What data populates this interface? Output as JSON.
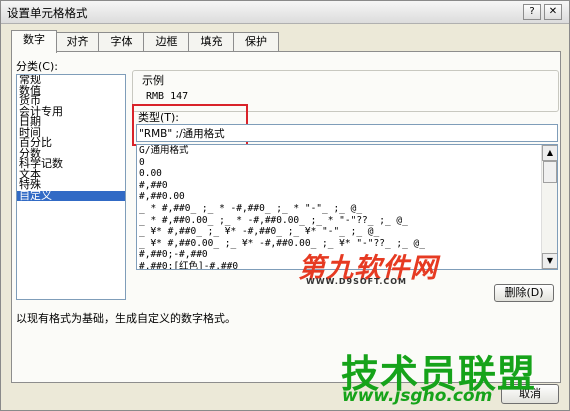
{
  "window": {
    "title": "设置单元格格式",
    "help_label": "?",
    "close_label": "✕"
  },
  "tabs": [
    "数字",
    "对齐",
    "字体",
    "边框",
    "填充",
    "保护"
  ],
  "category": {
    "label": "分类(C):",
    "items": [
      "常规",
      "数值",
      "货币",
      "会计专用",
      "日期",
      "时间",
      "百分比",
      "分数",
      "科学记数",
      "文本",
      "特殊",
      "自定义"
    ],
    "selected": "自定义"
  },
  "sample": {
    "label": "示例",
    "value": "RMB 147"
  },
  "type": {
    "label": "类型(T):",
    "value": "\"RMB\" ;/通用格式"
  },
  "format_list": [
    "G/通用格式",
    "0",
    "0.00",
    "#,##0",
    "#,##0.00",
    "_ * #,##0_ ;_ * -#,##0_ ;_ * \"-\"_ ;_ @_",
    "_ * #,##0.00_ ;_ * -#,##0.00_ ;_ * \"-\"??_ ;_ @_",
    "_ ¥* #,##0_ ;_ ¥* -#,##0_ ;_ ¥* \"-\"_ ;_ @_",
    "_ ¥* #,##0.00_ ;_ ¥* -#,##0.00_ ;_ ¥* \"-\"??_ ;_ @_",
    "#,##0;-#,##0",
    "#,##0;[红色]-#,##0"
  ],
  "delete_button": "删除(D)",
  "description": "以现有格式为基础，生成自定义的数字格式。",
  "cancel_button": "取消",
  "watermarks": {
    "brand1": "第九软件网",
    "brand1_url": "WWW.D9SOFT.COM",
    "brand2": "技术员联盟",
    "brand2_url": "www.jsgho.com"
  },
  "colors": {
    "highlight_box": "#d9232a",
    "selection": "#316ac5",
    "watermark_red": "#e63a22",
    "watermark_green": "#16a31a"
  }
}
